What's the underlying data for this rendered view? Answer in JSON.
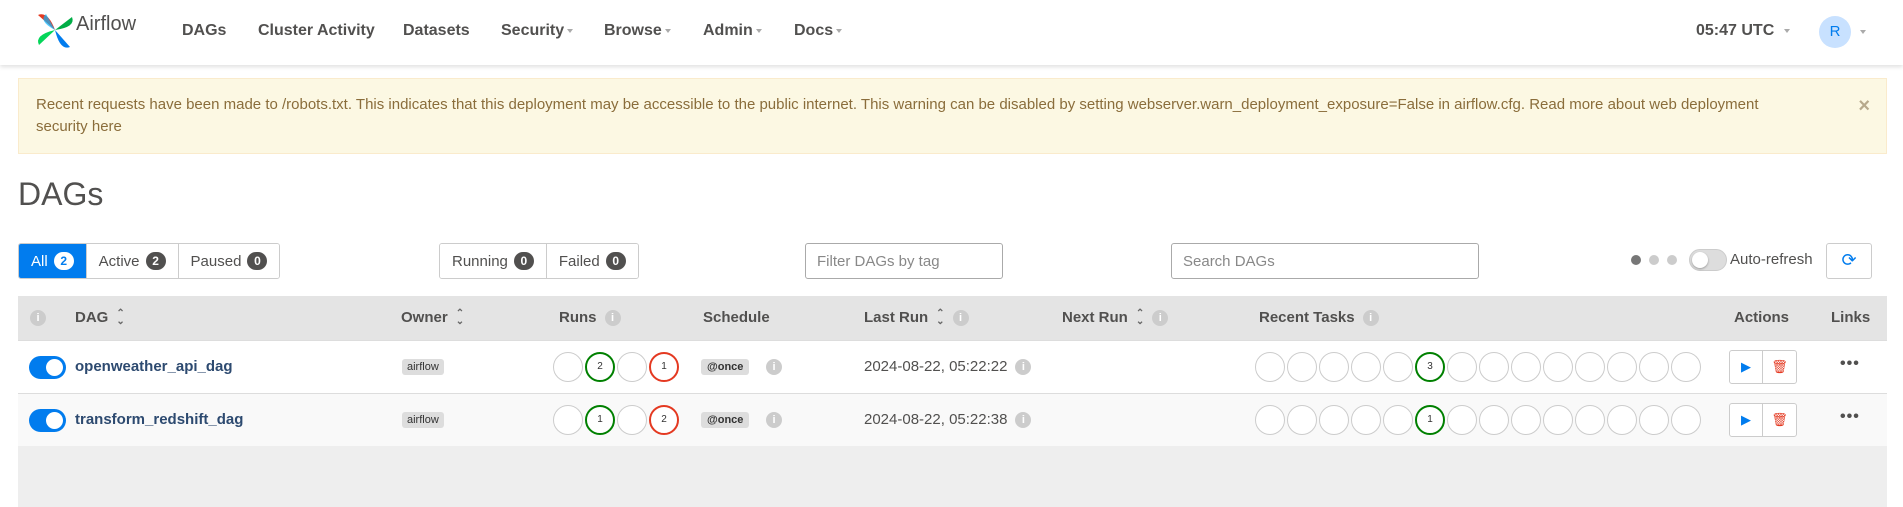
{
  "app": {
    "brand": "Airflow"
  },
  "nav": {
    "items": [
      {
        "label": "DAGs",
        "has_caret": false
      },
      {
        "label": "Cluster Activity",
        "has_caret": false
      },
      {
        "label": "Datasets",
        "has_caret": false
      },
      {
        "label": "Security",
        "has_caret": true
      },
      {
        "label": "Browse",
        "has_caret": true
      },
      {
        "label": "Admin",
        "has_caret": true
      },
      {
        "label": "Docs",
        "has_caret": true
      }
    ],
    "clock": "05:47 UTC",
    "avatar_initial": "R"
  },
  "alert": {
    "text": "Recent requests have been made to /robots.txt. This indicates that this deployment may be accessible to the public internet. This warning can be disabled by setting webserver.warn_deployment_exposure=False in airflow.cfg. Read more about web deployment security here",
    "close": "×"
  },
  "page": {
    "title": "DAGs"
  },
  "status_filters": [
    {
      "label": "All",
      "count": "2",
      "active": true
    },
    {
      "label": "Active",
      "count": "2",
      "active": false
    },
    {
      "label": "Paused",
      "count": "0",
      "active": false
    }
  ],
  "run_filters": [
    {
      "label": "Running",
      "count": "0"
    },
    {
      "label": "Failed",
      "count": "0"
    }
  ],
  "tag_filter": {
    "placeholder": "Filter DAGs by tag"
  },
  "search": {
    "placeholder": "Search DAGs"
  },
  "auto_refresh": {
    "label": "Auto-refresh",
    "enabled": false
  },
  "table": {
    "headers": {
      "dag": "DAG",
      "owner": "Owner",
      "runs": "Runs",
      "schedule": "Schedule",
      "last_run": "Last Run",
      "next_run": "Next Run",
      "recent_tasks": "Recent Tasks",
      "actions": "Actions",
      "links": "Links"
    },
    "rows": [
      {
        "dag_id": "openweather_api_dag",
        "owner": "airflow",
        "runs": [
          {
            "count": "",
            "color": "none"
          },
          {
            "count": "2",
            "color": "#008000"
          },
          {
            "count": "",
            "color": "none"
          },
          {
            "count": "1",
            "color": "#e43921"
          }
        ],
        "schedule": "@once",
        "last_run": "2024-08-22, 05:22:22",
        "next_run": "",
        "recent_tasks": [
          {
            "count": "",
            "color": "none"
          },
          {
            "count": "",
            "color": "none"
          },
          {
            "count": "",
            "color": "none"
          },
          {
            "count": "",
            "color": "none"
          },
          {
            "count": "",
            "color": "none"
          },
          {
            "count": "3",
            "color": "#008000"
          },
          {
            "count": "",
            "color": "none"
          },
          {
            "count": "",
            "color": "none"
          },
          {
            "count": "",
            "color": "none"
          },
          {
            "count": "",
            "color": "none"
          },
          {
            "count": "",
            "color": "none"
          },
          {
            "count": "",
            "color": "none"
          },
          {
            "count": "",
            "color": "none"
          },
          {
            "count": "",
            "color": "none"
          }
        ],
        "paused": false
      },
      {
        "dag_id": "transform_redshift_dag",
        "owner": "airflow",
        "runs": [
          {
            "count": "",
            "color": "none"
          },
          {
            "count": "1",
            "color": "#008000"
          },
          {
            "count": "",
            "color": "none"
          },
          {
            "count": "2",
            "color": "#e43921"
          }
        ],
        "schedule": "@once",
        "last_run": "2024-08-22, 05:22:38",
        "next_run": "",
        "recent_tasks": [
          {
            "count": "",
            "color": "none"
          },
          {
            "count": "",
            "color": "none"
          },
          {
            "count": "",
            "color": "none"
          },
          {
            "count": "",
            "color": "none"
          },
          {
            "count": "",
            "color": "none"
          },
          {
            "count": "1",
            "color": "#008000"
          },
          {
            "count": "",
            "color": "none"
          },
          {
            "count": "",
            "color": "none"
          },
          {
            "count": "",
            "color": "none"
          },
          {
            "count": "",
            "color": "none"
          },
          {
            "count": "",
            "color": "none"
          },
          {
            "count": "",
            "color": "none"
          },
          {
            "count": "",
            "color": "none"
          },
          {
            "count": "",
            "color": "none"
          }
        ],
        "paused": false
      }
    ]
  },
  "icons": {
    "brand": "airflow-pinwheel-icon",
    "refresh": "refresh-icon",
    "info": "info-icon",
    "sort": "sort-icon",
    "play": "play-icon",
    "delete": "trash-icon",
    "more": "ellipsis-icon"
  },
  "colors": {
    "accent": "#017cee",
    "success": "#008000",
    "failed": "#e43921",
    "alert_bg": "#fcf8e3",
    "alert_text": "#8a6d3b"
  }
}
